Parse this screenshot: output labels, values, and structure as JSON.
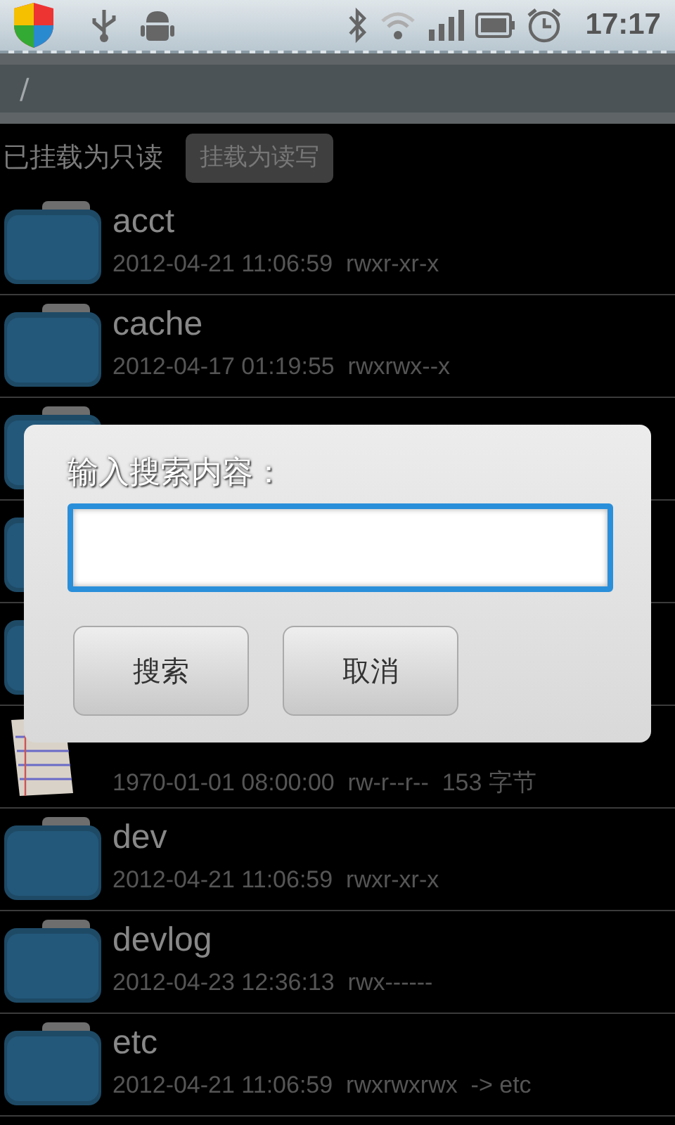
{
  "status_bar": {
    "time": "17:17"
  },
  "path_bar": {
    "path": "/"
  },
  "mount": {
    "status": "已挂载为只读",
    "button": "挂载为读写"
  },
  "files": [
    {
      "kind": "folder",
      "name": "acct",
      "meta": "2012-04-21 11:06:59  rwxr-xr-x"
    },
    {
      "kind": "folder",
      "name": "cache",
      "meta": "2012-04-17 01:19:55  rwxrwx--x"
    },
    {
      "kind": "folder"
    },
    {
      "kind": "folder"
    },
    {
      "kind": "folder"
    },
    {
      "kind": "file",
      "meta": "1970-01-01 08:00:00  rw-r--r--  153 字节"
    },
    {
      "kind": "folder",
      "name": "dev",
      "meta": "2012-04-21 11:06:59  rwxr-xr-x"
    },
    {
      "kind": "folder",
      "name": "devlog",
      "meta": "2012-04-23 12:36:13  rwx------"
    },
    {
      "kind": "folder",
      "name": "etc",
      "meta": "2012-04-21 11:06:59  rwxrwxrwx  -> etc"
    }
  ],
  "dialog": {
    "title": "输入搜索内容：",
    "buttons": [
      "搜索",
      "取消"
    ]
  }
}
